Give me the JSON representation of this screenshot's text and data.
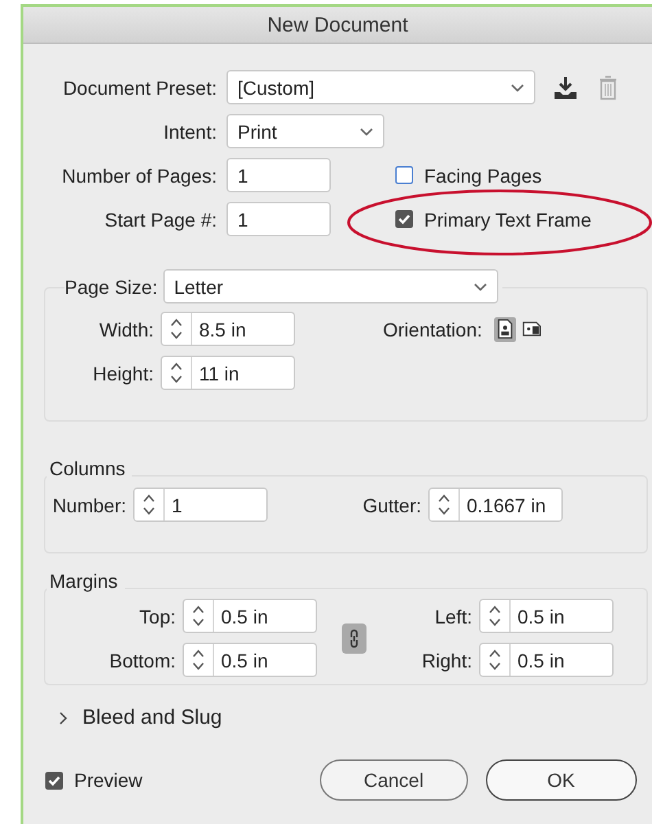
{
  "window": {
    "title": "New Document"
  },
  "document_preset": {
    "label": "Document Preset:",
    "value": "[Custom]"
  },
  "intent": {
    "label": "Intent:",
    "value": "Print"
  },
  "number_of_pages": {
    "label": "Number of Pages:",
    "value": "1"
  },
  "start_page": {
    "label": "Start Page #:",
    "value": "1"
  },
  "options": [
    {
      "label": "Facing Pages",
      "checked": false,
      "highlighted": false
    },
    {
      "label": "Primary Text Frame",
      "checked": true,
      "highlighted": true
    }
  ],
  "page_size": {
    "label": "Page Size:",
    "value": "Letter",
    "fields": [
      {
        "label": "Width:",
        "value": "8.5 in"
      },
      {
        "label": "Height:",
        "value": "11 in"
      }
    ],
    "orientation": {
      "label": "Orientation:",
      "options": [
        {
          "kind": "portrait",
          "selected": true
        },
        {
          "kind": "landscape",
          "selected": false
        }
      ]
    }
  },
  "columns": {
    "title": "Columns",
    "number": {
      "label": "Number:",
      "value": "1"
    },
    "gutter": {
      "label": "Gutter:",
      "value": "0.1667 in"
    }
  },
  "margins": {
    "title": "Margins",
    "left_fields": [
      {
        "label": "Top:",
        "value": "0.5 in"
      },
      {
        "label": "Bottom:",
        "value": "0.5 in"
      }
    ],
    "right_fields": [
      {
        "label": "Left:",
        "value": "0.5 in"
      },
      {
        "label": "Right:",
        "value": "0.5 in"
      }
    ],
    "linked": true
  },
  "bleed_and_slug": {
    "label": "Bleed and Slug",
    "expanded": false
  },
  "preview": {
    "label": "Preview",
    "checked": true
  },
  "buttons": [
    {
      "label": "Cancel",
      "default": false
    },
    {
      "label": "OK",
      "default": true
    }
  ]
}
